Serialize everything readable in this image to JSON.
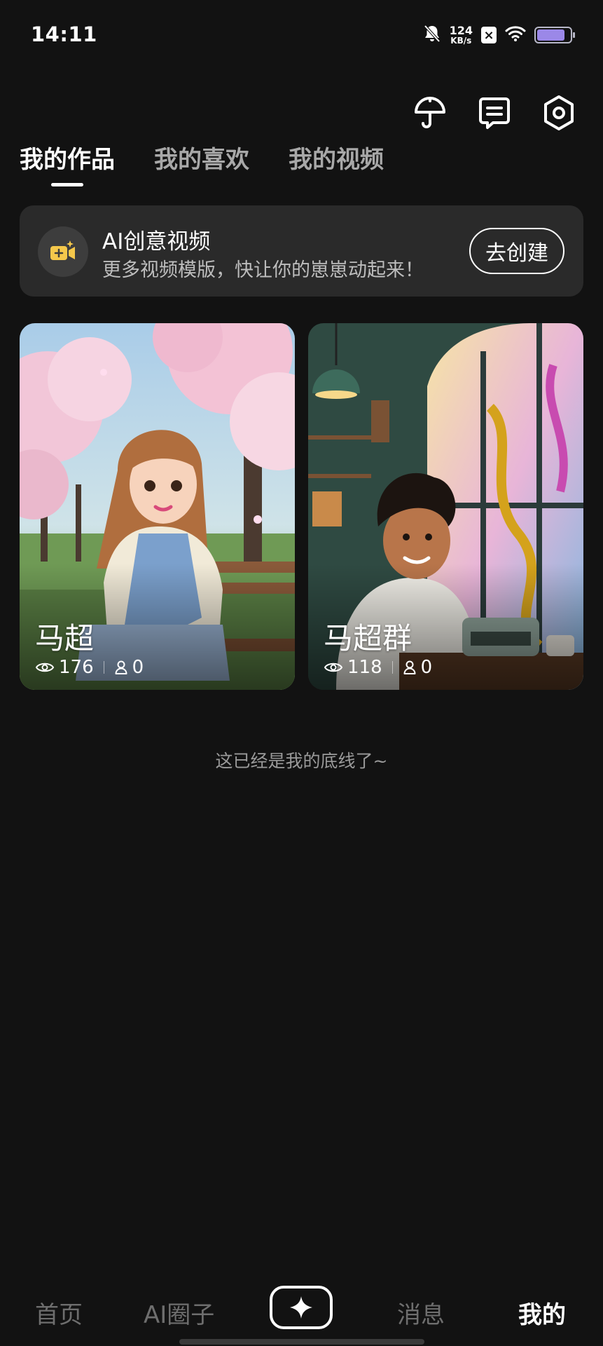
{
  "status_bar": {
    "time": "14:11",
    "net_speed": "124",
    "net_unit": "KB/s",
    "battery_level": 0.85
  },
  "top_actions": [
    {
      "name": "umbrella-icon"
    },
    {
      "name": "message-icon"
    },
    {
      "name": "settings-icon"
    }
  ],
  "tabs": [
    {
      "label": "我的作品",
      "active": true
    },
    {
      "label": "我的喜欢",
      "active": false
    },
    {
      "label": "我的视频",
      "active": false
    }
  ],
  "banner": {
    "title": "AI创意视频",
    "subtitle": "更多视频模版，快让你的崽崽动起来！",
    "button": "去创建",
    "icon": "video-sparkle-icon",
    "icon_color": "#f5c84b"
  },
  "cards": [
    {
      "name": "马超",
      "views": "176",
      "members": "0",
      "image": "cherry-blossom-girl"
    },
    {
      "name": "马超群",
      "views": "118",
      "members": "0",
      "image": "cafe-boy-typewriter"
    }
  ],
  "end_text": "这已经是我的底线了~",
  "bottom_nav": {
    "items": [
      {
        "label": "首页",
        "active": false
      },
      {
        "label": "AI圈子",
        "active": false
      },
      {
        "label": "消息",
        "active": false
      },
      {
        "label": "我的",
        "active": true
      }
    ],
    "create_icon": "sparkle-icon"
  }
}
